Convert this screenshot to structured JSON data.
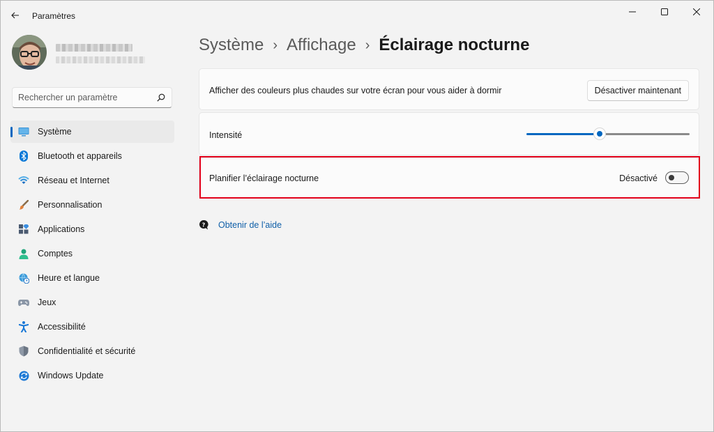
{
  "window": {
    "title": "Paramètres"
  },
  "search": {
    "placeholder": "Rechercher un paramètre"
  },
  "sidebar": {
    "items": [
      {
        "label": "Système",
        "icon": "display-icon",
        "active": true
      },
      {
        "label": "Bluetooth et appareils",
        "icon": "bluetooth-icon"
      },
      {
        "label": "Réseau et Internet",
        "icon": "wifi-icon"
      },
      {
        "label": "Personnalisation",
        "icon": "brush-icon"
      },
      {
        "label": "Applications",
        "icon": "apps-icon"
      },
      {
        "label": "Comptes",
        "icon": "person-icon"
      },
      {
        "label": "Heure et langue",
        "icon": "globe-clock-icon"
      },
      {
        "label": "Jeux",
        "icon": "gamepad-icon"
      },
      {
        "label": "Accessibilité",
        "icon": "accessibility-icon"
      },
      {
        "label": "Confidentialité et sécurité",
        "icon": "shield-icon"
      },
      {
        "label": "Windows Update",
        "icon": "update-icon"
      }
    ]
  },
  "breadcrumb": {
    "level1": "Système",
    "level2": "Affichage",
    "current": "Éclairage nocturne"
  },
  "settings": {
    "night_light": {
      "label": "Afficher des couleurs plus chaudes sur votre écran pour vous aider à dormir",
      "button": "Désactiver maintenant"
    },
    "intensity": {
      "label": "Intensité",
      "value_fraction": 0.45
    },
    "schedule": {
      "label": "Planifier l’éclairage nocturne",
      "state": "Désactivé",
      "on": false
    }
  },
  "help": {
    "label": "Obtenir de l’aide"
  },
  "colors": {
    "accent": "#0067c0",
    "highlight": "#e2001a"
  }
}
